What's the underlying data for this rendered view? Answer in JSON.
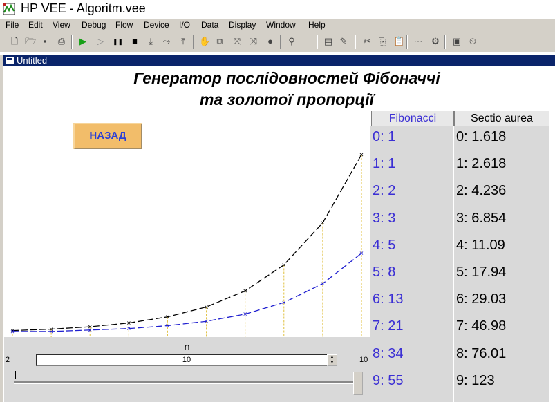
{
  "window": {
    "title": "HP VEE - Algoritm.vee",
    "subwindow_title": "Untitled"
  },
  "menu": [
    "File",
    "Edit",
    "View",
    "Debug",
    "Flow",
    "Device",
    "I/O",
    "Data",
    "Display",
    "Window",
    "Help"
  ],
  "toolbar": [
    "new-icon",
    "open-icon",
    "save-icon",
    "print-icon",
    "run-icon",
    "step-icon",
    "pause-icon",
    "stop-icon",
    "step-into-icon",
    "step-over-icon",
    "step-out-icon",
    "hand-icon",
    "copy-object-icon",
    "bring-icon",
    "cut-bring-icon",
    "circle-icon",
    "find-icon",
    "properties-icon",
    "edit-icon",
    "cut-icon",
    "copy-icon",
    "paste-icon",
    "line-probe-icon",
    "settings-icon",
    "panel-view-icon",
    "clock-icon"
  ],
  "panel": {
    "title_line1": "Генератор послідовностей Фібоначчі",
    "title_line2": "та золотої пропорції",
    "back_button": "НАЗАД"
  },
  "fibonacci": {
    "header": "Fibonacci",
    "rows": [
      "0: 1",
      "1: 1",
      "2: 2",
      "3: 3",
      "4: 5",
      "5: 8",
      "6: 13",
      "7: 21",
      "8: 34",
      "9: 55"
    ],
    "color": "#3b2fd4"
  },
  "sectio": {
    "header": "Sectio aurea",
    "rows": [
      "0: 1.618",
      "1: 2.618",
      "2: 4.236",
      "3: 6.854",
      "4: 11.09",
      "5: 17.94",
      "6: 29.03",
      "7: 46.98",
      "8: 76.01",
      "9: 123"
    ]
  },
  "slider": {
    "label": "n",
    "min": "2",
    "max": "10",
    "value": "10",
    "fraction": 1.0
  },
  "chart_data": {
    "type": "line",
    "x": [
      0,
      1,
      2,
      3,
      4,
      5,
      6,
      7,
      8,
      9
    ],
    "series": [
      {
        "values": [
          1.618,
          2.618,
          4.236,
          6.854,
          11.09,
          17.94,
          29.03,
          46.98,
          76.01,
          123
        ],
        "color": "#000000"
      },
      {
        "values": [
          1,
          1,
          2,
          3,
          5,
          8,
          13,
          21,
          34,
          55
        ],
        "color": "#2020d0"
      }
    ],
    "grid_color": "#e0c040"
  }
}
